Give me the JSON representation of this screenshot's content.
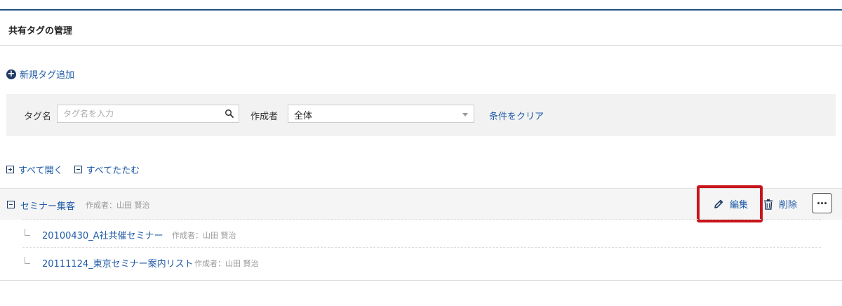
{
  "page": {
    "title": "共有タグの管理"
  },
  "actions": {
    "add_tag_label": "新規タグ追加"
  },
  "filter": {
    "tag_label": "タグ名",
    "tag_placeholder": "タグ名を入力",
    "tag_value": "",
    "author_label": "作成者",
    "author_selected": "全体",
    "clear_label": "条件をクリア"
  },
  "tree_controls": {
    "expand_all": "すべて開く",
    "collapse_all": "すべてたたむ"
  },
  "tags": [
    {
      "name": "セミナー集客",
      "author": "作成者：山田 賢治",
      "expanded": true,
      "edit_label": "編集",
      "delete_label": "削除",
      "children": [
        {
          "name": "20100430_A社共催セミナー",
          "author": "作成者：山田 賢治"
        },
        {
          "name": "20111124_東京セミナー案内リスト",
          "author": "作成者：山田 賢治"
        }
      ]
    }
  ],
  "colors": {
    "link": "#1f5aa6",
    "header_rule": "#1f4e79",
    "highlight": "#c8151b"
  },
  "icons": [
    "plus-circle-icon",
    "search-icon",
    "chevron-down-icon",
    "expand-square-icon",
    "collapse-square-icon",
    "pencil-icon",
    "trash-icon",
    "more-icon"
  ]
}
